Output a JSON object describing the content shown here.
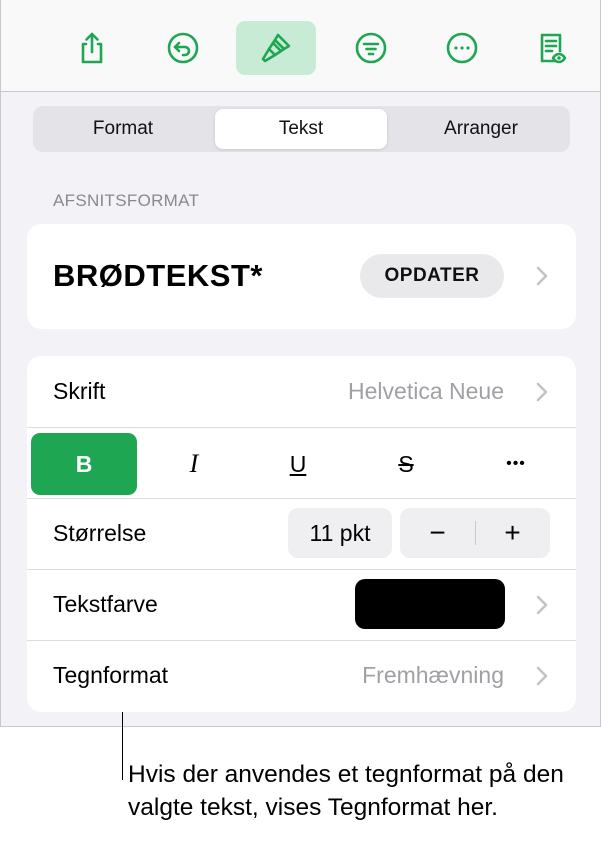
{
  "toolbar": {
    "icons": [
      "share-icon",
      "undo-icon",
      "paintbrush-icon",
      "filter-icon",
      "more-icon",
      "reading-view-icon"
    ],
    "accent": "#1fa652",
    "active_bg": "#c8ebd6"
  },
  "tabs": [
    "Format",
    "Tekst",
    "Arranger"
  ],
  "selected_tab": "Tekst",
  "paragraph_style": {
    "section_label": "AFSNITSFORMAT",
    "name": "BRØDTEKST*",
    "update_label": "OPDATER"
  },
  "font": {
    "label": "Skrift",
    "value": "Helvetica Neue"
  },
  "format_buttons": {
    "bold": "B",
    "italic": "I",
    "underline": "U",
    "strike": "S",
    "more": "•••"
  },
  "size": {
    "label": "Størrelse",
    "value": "11 pkt",
    "minus": "−",
    "plus": "+"
  },
  "text_color": {
    "label": "Tekstfarve",
    "color": "#000000"
  },
  "char_style": {
    "label": "Tegnformat",
    "value": "Fremhævning"
  },
  "callout": "Hvis der anvendes et tegnformat på den valgte tekst, vises Tegnformat her."
}
